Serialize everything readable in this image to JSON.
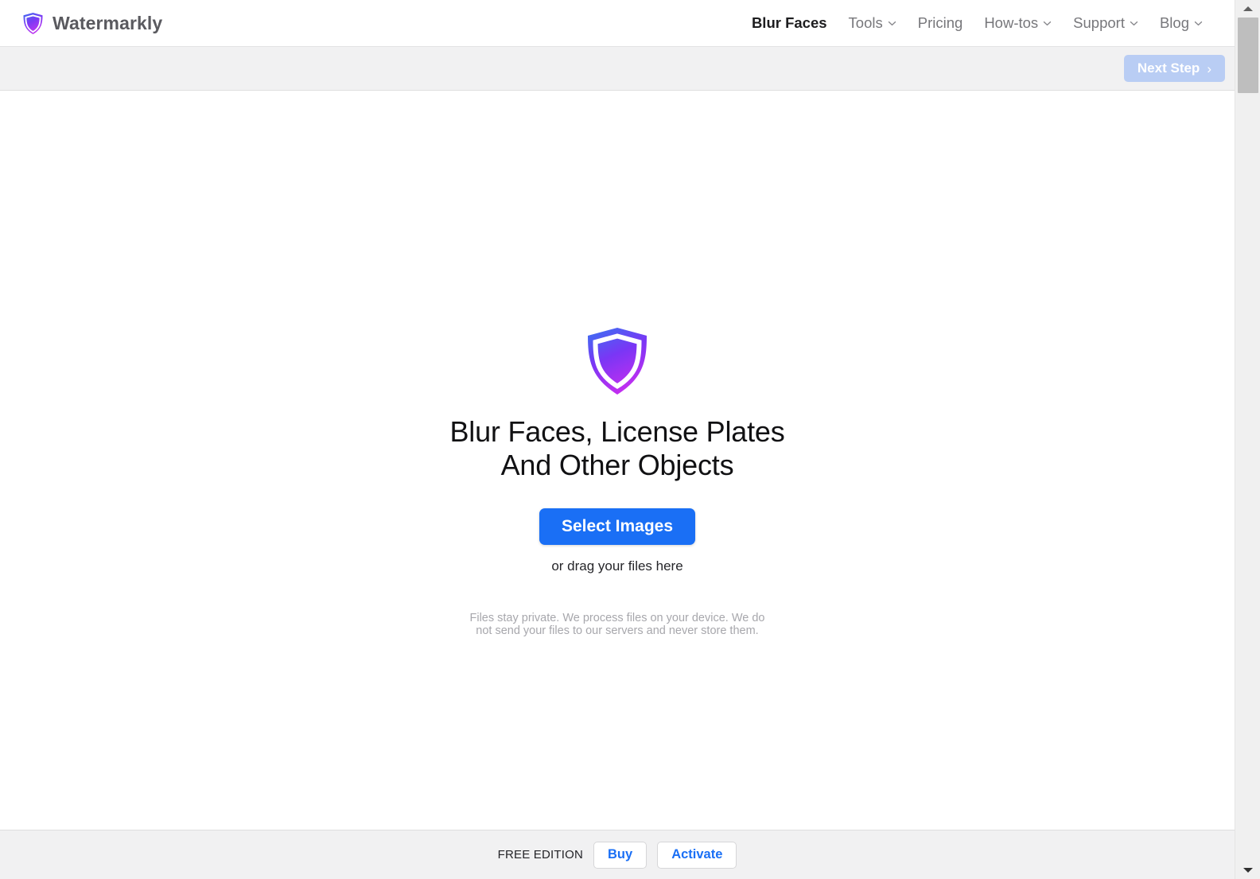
{
  "header": {
    "brand_name": "Watermarkly",
    "brand_icon": "shield-icon",
    "nav": [
      {
        "label": "Blur Faces",
        "has_dropdown": false,
        "active": true
      },
      {
        "label": "Tools",
        "has_dropdown": true,
        "active": false
      },
      {
        "label": "Pricing",
        "has_dropdown": false,
        "active": false
      },
      {
        "label": "How-tos",
        "has_dropdown": true,
        "active": false
      },
      {
        "label": "Support",
        "has_dropdown": true,
        "active": false
      },
      {
        "label": "Blog",
        "has_dropdown": true,
        "active": false
      }
    ]
  },
  "toolbar": {
    "next_step_label": "Next Step",
    "next_step_icon": "chevron-right-icon",
    "next_step_disabled": true,
    "next_step_color": "#b9cdf4"
  },
  "hero": {
    "logo_icon": "shield-icon",
    "title_line1": "Blur Faces, License Plates",
    "title_line2": "And Other Objects",
    "select_button_label": "Select Images",
    "select_button_color": "#1a6ff5",
    "drag_hint": "or drag your files here",
    "privacy_line1": "Files stay private. We process files on your device. We do",
    "privacy_line2": "not send your files to our servers and never store them."
  },
  "footer": {
    "edition_label": "FREE EDITION",
    "buy_label": "Buy",
    "activate_label": "Activate",
    "link_color": "#1a6ff5"
  },
  "scrollbar": {
    "up_icon": "triangle-up-icon",
    "down_icon": "triangle-down-icon"
  }
}
